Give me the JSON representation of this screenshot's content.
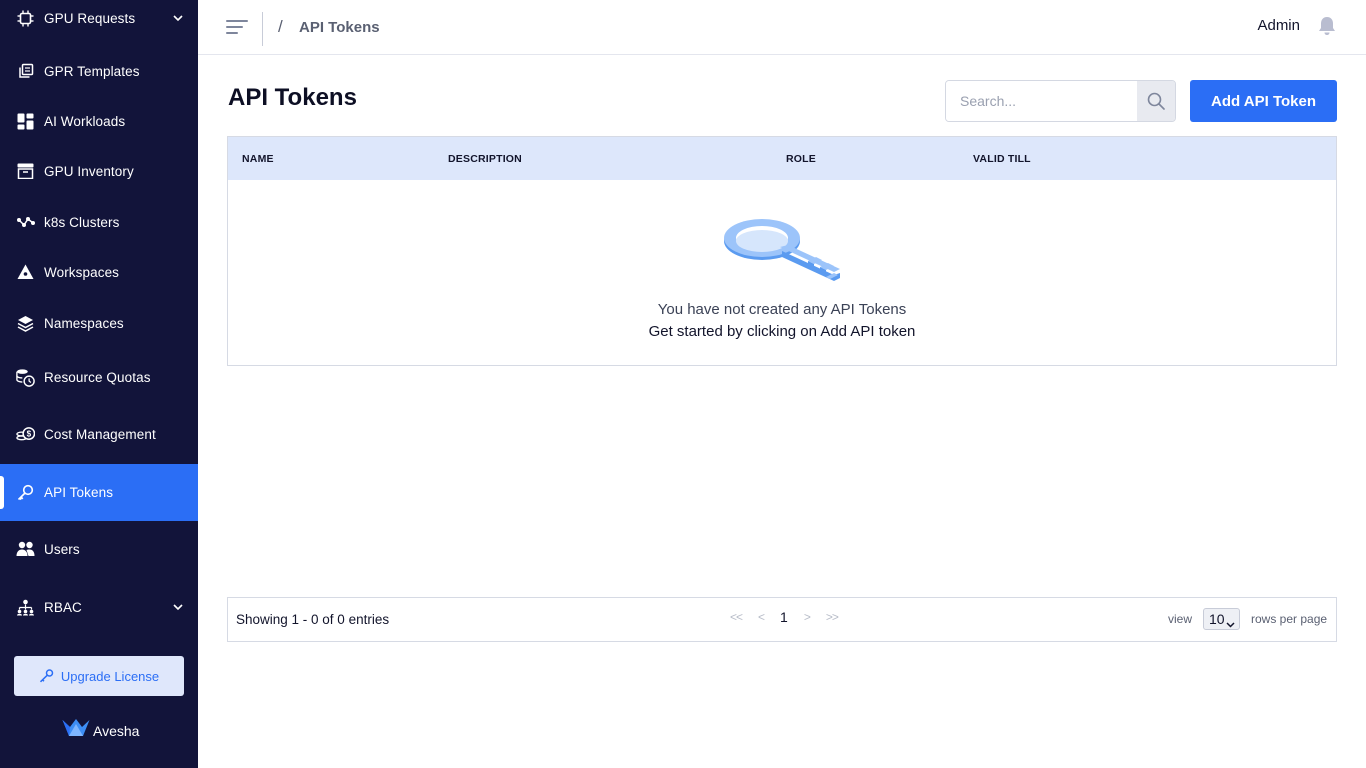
{
  "sidebar": {
    "items": [
      {
        "label": "GPU Requests",
        "icon": "chip-icon",
        "has_chevron": true
      },
      {
        "label": "GPR Templates",
        "icon": "template-icon"
      },
      {
        "label": "AI Workloads",
        "icon": "grid-icon"
      },
      {
        "label": "GPU Inventory",
        "icon": "inventory-box-icon"
      },
      {
        "label": "k8s Clusters",
        "icon": "cluster-nodes-icon"
      },
      {
        "label": "Workspaces",
        "icon": "workspace-icon"
      },
      {
        "label": "Namespaces",
        "icon": "layers-icon"
      },
      {
        "label": "Resource Quotas",
        "icon": "quota-clock-icon"
      },
      {
        "label": "Cost Management",
        "icon": "cost-coins-icon"
      },
      {
        "label": "API Tokens",
        "icon": "key-icon",
        "active": true
      },
      {
        "label": "Users",
        "icon": "users-icon"
      },
      {
        "label": "RBAC",
        "icon": "rbac-icon",
        "has_chevron": true
      }
    ],
    "upgrade_label": "Upgrade License",
    "brand_name": "Avesha"
  },
  "header": {
    "breadcrumb_sep": "/",
    "breadcrumb": "API Tokens",
    "user": "Admin"
  },
  "main": {
    "title": "API Tokens",
    "search_placeholder": "Search...",
    "add_button": "Add API Token",
    "columns": [
      "NAME",
      "DESCRIPTION",
      "ROLE",
      "VALID TILL"
    ],
    "empty_line1": "You have not created any API Tokens",
    "empty_line2": "Get started by clicking on Add API token"
  },
  "pagination": {
    "showing": "Showing 1 - 0 of 0 entries",
    "first": "<<",
    "prev": "<",
    "current_page": "1",
    "next": ">",
    "last": ">>",
    "view_label": "view",
    "rows_per_page_value": "10",
    "rows_per_page_label": "rows per page"
  },
  "colors": {
    "sidebar_bg": "#12143a",
    "accent": "#2b6ef5",
    "table_header_bg": "#dde7fb"
  }
}
